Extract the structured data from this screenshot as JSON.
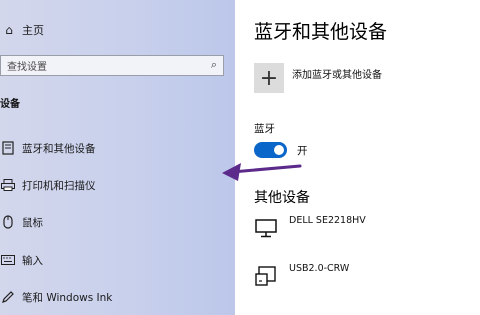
{
  "sidebar": {
    "home_label": "主页",
    "search_placeholder": "查找设置",
    "section_title": "设备",
    "items": [
      {
        "label": "蓝牙和其他设备",
        "icon": "bluetooth-devices-icon"
      },
      {
        "label": "打印机和扫描仪",
        "icon": "printer-icon"
      },
      {
        "label": "鼠标",
        "icon": "mouse-icon"
      },
      {
        "label": "输入",
        "icon": "keyboard-icon"
      },
      {
        "label": "笔和 Windows Ink",
        "icon": "pen-icon"
      }
    ]
  },
  "main": {
    "title": "蓝牙和其他设备",
    "add_label": "添加蓝牙或其他设备",
    "bluetooth_label": "蓝牙",
    "bluetooth_state": "开",
    "other_devices_title": "其他设备",
    "devices": [
      {
        "name": "DELL SE2218HV",
        "icon": "monitor-icon"
      },
      {
        "name": "USB2.0-CRW",
        "icon": "card-reader-icon"
      }
    ]
  },
  "colors": {
    "toggle_on": "#0a66c9",
    "annotation_arrow": "#5b2a8a"
  }
}
